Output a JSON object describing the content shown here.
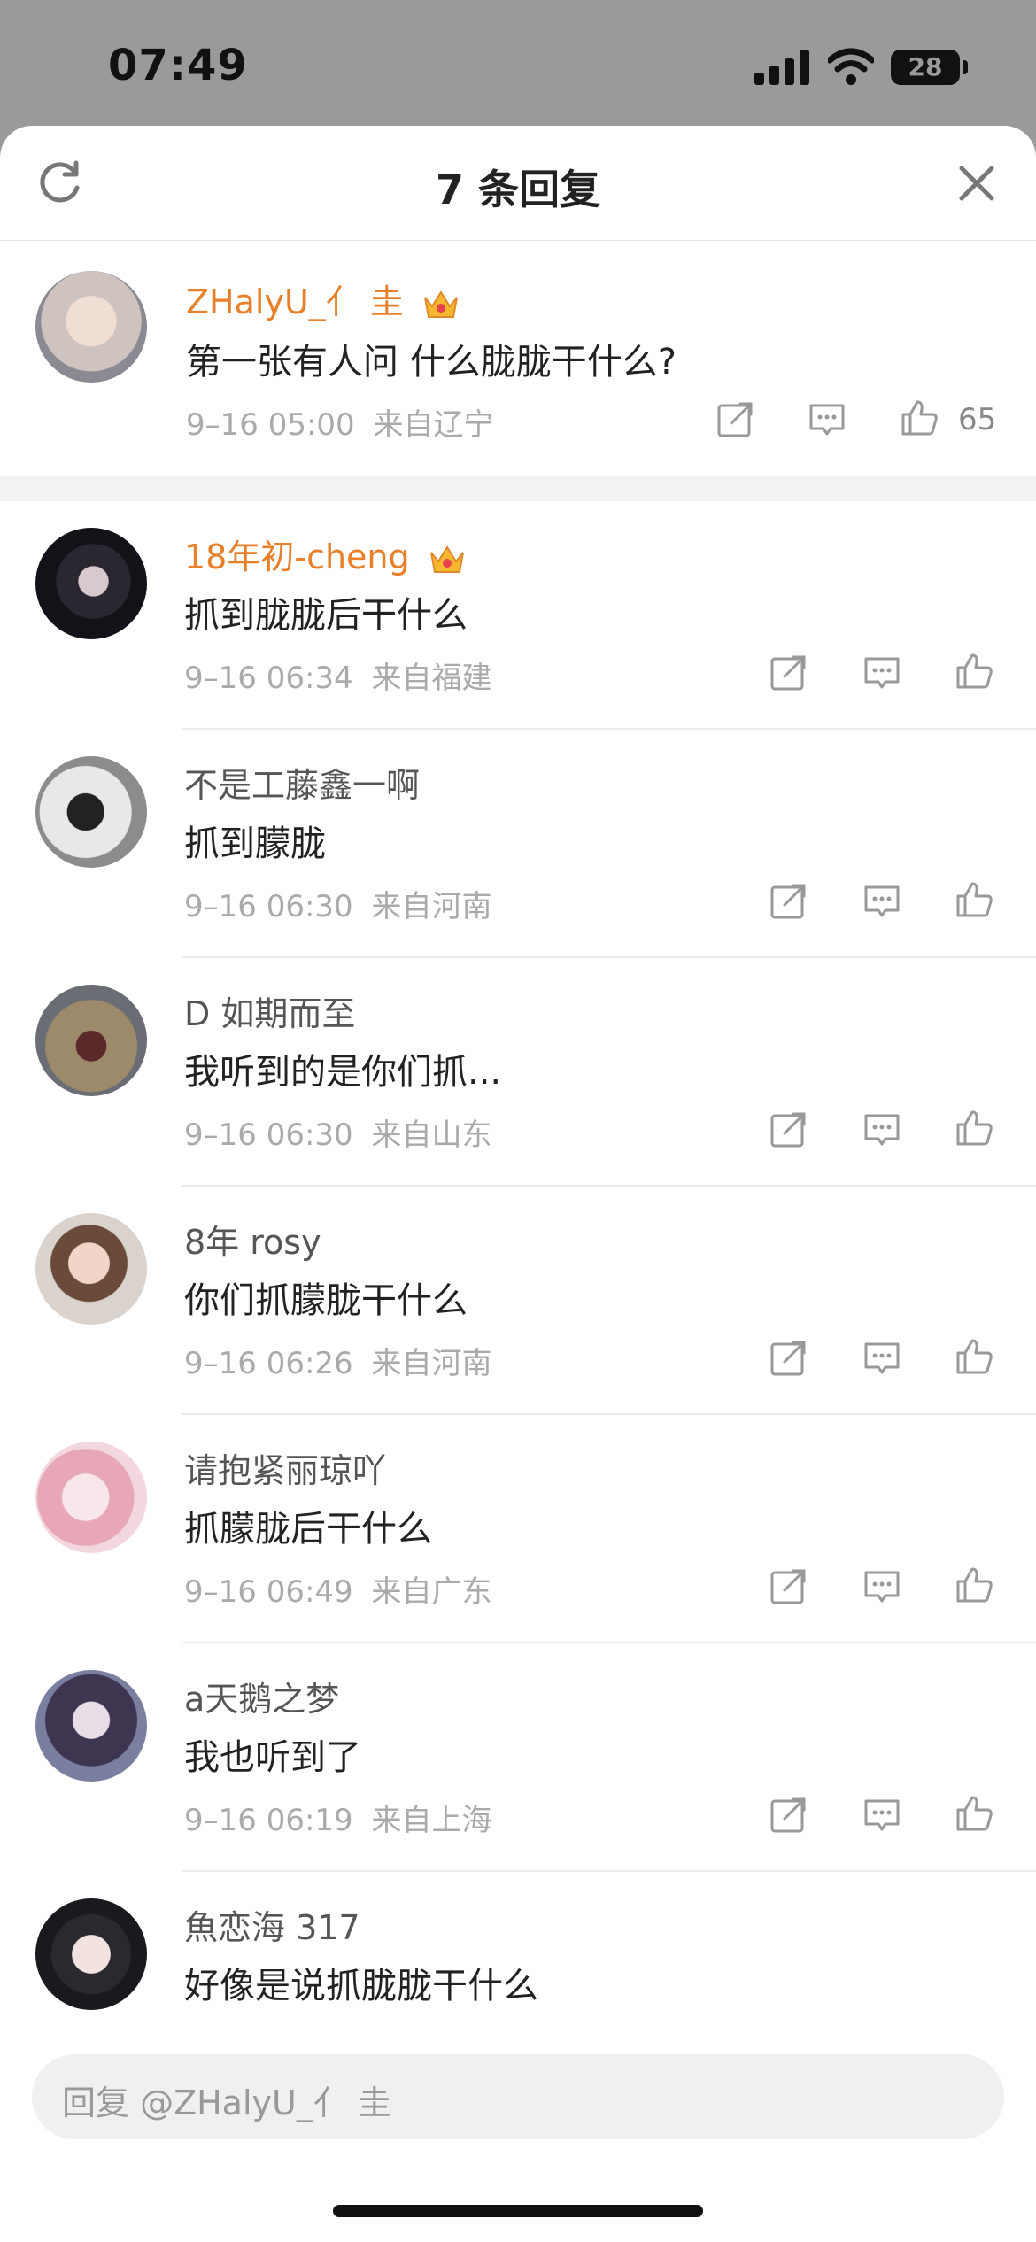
{
  "status": {
    "time": "07:49",
    "battery": "28"
  },
  "header": {
    "title": "7 条回复",
    "refresh_icon": "refresh-icon",
    "close_icon": "close-icon"
  },
  "main_comment": {
    "username": "ZHalyU_亻 圭",
    "vip_badge": "crown-icon",
    "text": "第一张有人问 什么胧胧干什么?",
    "time": "9–16 05:00",
    "location": "来自辽宁",
    "likes": "65"
  },
  "replies": [
    {
      "username": "18年初-cheng",
      "vip": true,
      "text": "抓到胧胧后干什么",
      "time": "9–16 06:34",
      "location": "来自福建"
    },
    {
      "username": "不是工藤鑫一啊",
      "vip": false,
      "text": "抓到朦胧",
      "time": "9–16 06:30",
      "location": "来自河南"
    },
    {
      "username": "D 如期而至",
      "vip": false,
      "text": "我听到的是你们抓...",
      "time": "9–16 06:30",
      "location": "来自山东"
    },
    {
      "username": "8年 rosy",
      "vip": false,
      "text": "你们抓朦胧干什么",
      "time": "9–16 06:26",
      "location": "来自河南"
    },
    {
      "username": "请抱紧丽琼吖",
      "vip": false,
      "text": "抓朦胧后干什么",
      "time": "9–16 06:49",
      "location": "来自广东"
    },
    {
      "username": "a天鹅之梦",
      "vip": false,
      "text": "我也听到了",
      "time": "9–16 06:19",
      "location": "来自上海"
    },
    {
      "username": "魚恋海 317",
      "vip": false,
      "text": "好像是说抓胧胧干什么",
      "time": "",
      "location": ""
    }
  ],
  "reply_input": {
    "placeholder": "回复 @ZHalyU_亻 圭"
  },
  "colors": {
    "accent_username": "#e8802a",
    "meta_text": "#aaaaaa",
    "band": "#f2f2f2"
  }
}
